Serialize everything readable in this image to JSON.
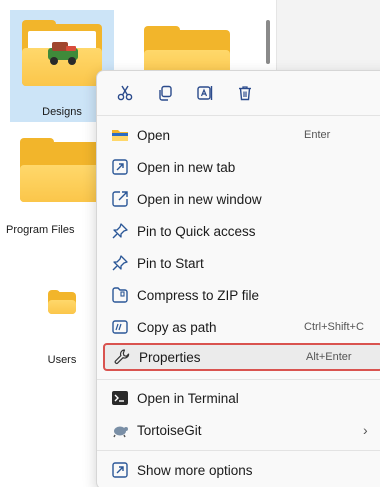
{
  "files": [
    {
      "label": "Designs",
      "icon": "folder-icon",
      "selected": true
    },
    {
      "label": "Program Files",
      "icon": "folder-icon",
      "selected": false
    },
    {
      "label": "Users",
      "icon": "folder-icon",
      "selected": false
    }
  ],
  "quick_actions": [
    {
      "name": "cut",
      "icon": "scissors-icon"
    },
    {
      "name": "copy",
      "icon": "copy-icon"
    },
    {
      "name": "rename",
      "icon": "rename-icon"
    },
    {
      "name": "delete",
      "icon": "trash-icon"
    }
  ],
  "menu": {
    "items": [
      {
        "label": "Open",
        "shortcut": "Enter",
        "icon": "folder-icon"
      },
      {
        "label": "Open in new tab",
        "shortcut": "",
        "icon": "new-tab-icon"
      },
      {
        "label": "Open in new window",
        "shortcut": "",
        "icon": "new-window-icon"
      },
      {
        "label": "Pin to Quick access",
        "shortcut": "",
        "icon": "pin-icon"
      },
      {
        "label": "Pin to Start",
        "shortcut": "",
        "icon": "pin-icon"
      },
      {
        "label": "Compress to ZIP file",
        "shortcut": "",
        "icon": "zip-icon"
      },
      {
        "label": "Copy as path",
        "shortcut": "Ctrl+Shift+C",
        "icon": "path-icon"
      },
      {
        "label": "Properties",
        "shortcut": "Alt+Enter",
        "icon": "wrench-icon",
        "highlighted": true
      },
      {
        "label": "Open in Terminal",
        "shortcut": "",
        "icon": "terminal-icon"
      },
      {
        "label": "TortoiseGit",
        "shortcut": "",
        "icon": "tortoisegit-icon",
        "submenu": true
      },
      {
        "label": "Show more options",
        "shortcut": "",
        "icon": "more-options-icon"
      }
    ],
    "submenu_indicator": "›"
  },
  "colors": {
    "selection": "#cce4f7",
    "highlight_border": "#d9534f",
    "icon_blue": "#2b5797",
    "folder": "#f2b52b"
  }
}
